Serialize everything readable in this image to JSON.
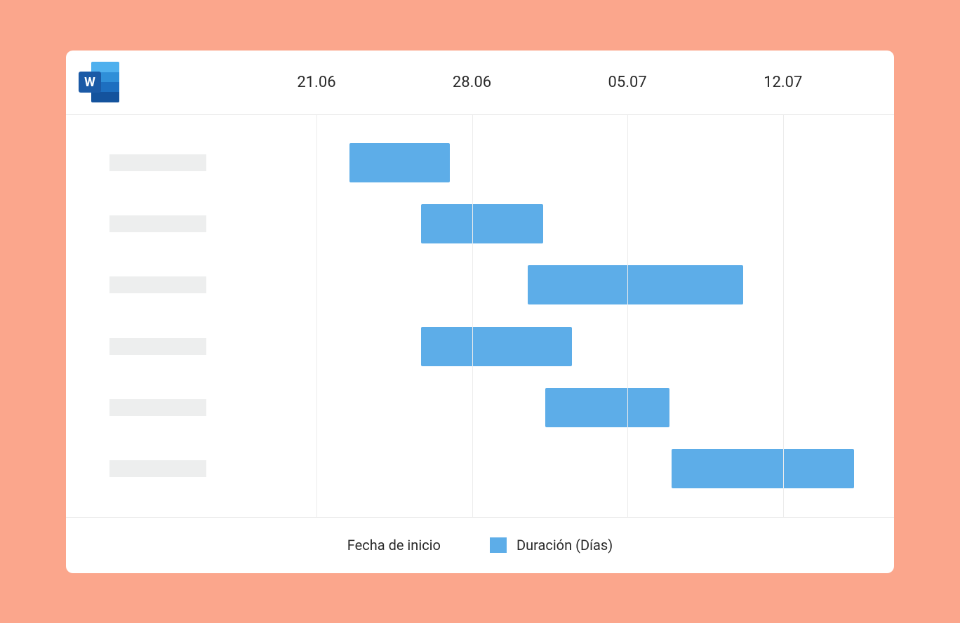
{
  "chart_data": {
    "type": "bar",
    "orientation": "horizontal-gantt",
    "title": "",
    "xlabel": "",
    "ylabel": "",
    "x_ticks": [
      "21.06",
      "28.06",
      "05.07",
      "12.07"
    ],
    "x_range_days": [
      18,
      47
    ],
    "tasks": [
      {
        "start_day": 22.5,
        "duration_days": 4.5
      },
      {
        "start_day": 25.7,
        "duration_days": 5.5
      },
      {
        "start_day": 30.5,
        "duration_days": 9.7
      },
      {
        "start_day": 25.7,
        "duration_days": 6.8
      },
      {
        "start_day": 31.3,
        "duration_days": 5.6
      },
      {
        "start_day": 37.0,
        "duration_days": 8.2
      }
    ]
  },
  "legend": {
    "start_label": "Fecha de inicio",
    "duration_label": "Duración (Días)"
  },
  "icon": {
    "word_letter": "W"
  },
  "colors": {
    "bar": "#5dade8",
    "bg": "#fba68c"
  }
}
